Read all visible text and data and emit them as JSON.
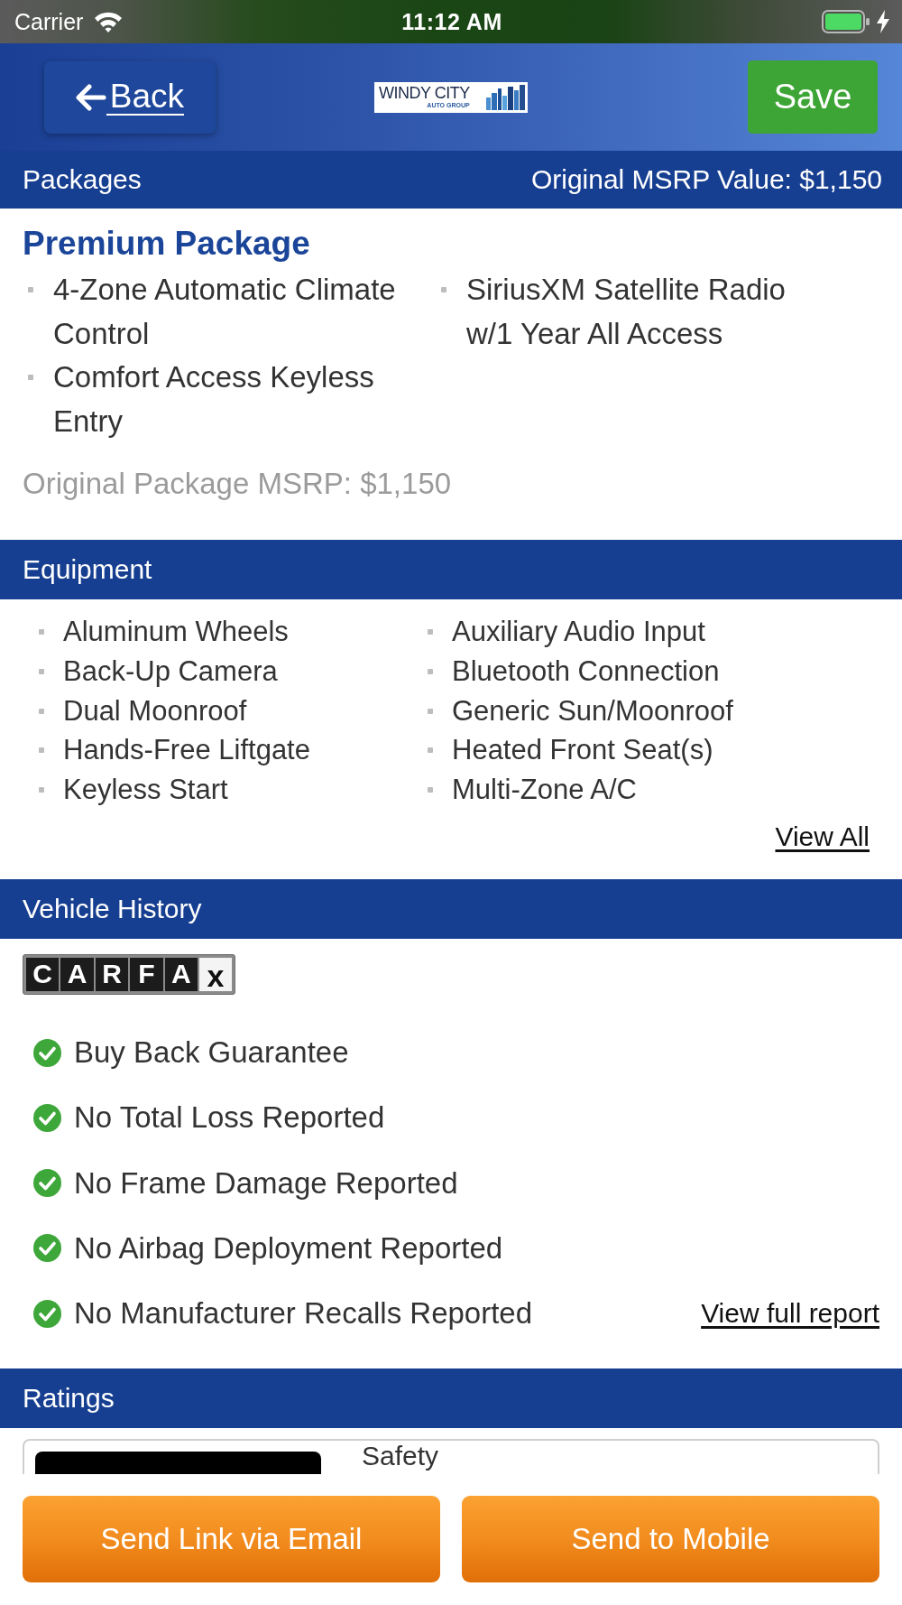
{
  "status_bar": {
    "carrier": "Carrier",
    "time": "11:12 AM"
  },
  "header": {
    "back": "Back",
    "logo": {
      "name": "WINDY CITY",
      "tagline": "AUTO GROUP"
    },
    "save": "Save"
  },
  "packages": {
    "title": "Packages",
    "msrp_value": "Original MSRP Value: $1,150",
    "items": [
      {
        "name": "Premium Package",
        "features": [
          "4-Zone Automatic Climate Control",
          "Comfort Access Keyless Entry",
          "SiriusXM Satellite Radio w/1 Year All Access"
        ],
        "msrp": "Original Package MSRP: $1,150"
      }
    ]
  },
  "equipment": {
    "title": "Equipment",
    "items": [
      "Aluminum Wheels",
      "Auxiliary Audio Input",
      "Back-Up Camera",
      "Bluetooth Connection",
      "Dual Moonroof",
      "Generic Sun/Moonroof",
      "Hands-Free Liftgate",
      "Heated Front Seat(s)",
      "Keyless Start",
      "Multi-Zone A/C"
    ],
    "view_all": "View All"
  },
  "vehicle_history": {
    "title": "Vehicle History",
    "logo": {
      "tiles": [
        "C",
        "A",
        "R",
        "F",
        "A"
      ],
      "suffix": "x"
    },
    "items": [
      "Buy Back Guarantee",
      "No Total Loss Reported",
      "No Frame Damage Reported",
      "No Airbag Deployment Reported",
      "No Manufacturer Recalls Reported"
    ],
    "report_link": "View full report"
  },
  "ratings": {
    "title": "Ratings",
    "cards": [
      {
        "label": "Safety"
      }
    ]
  },
  "actions": [
    "Send Link via Email",
    "Send to Mobile"
  ]
}
